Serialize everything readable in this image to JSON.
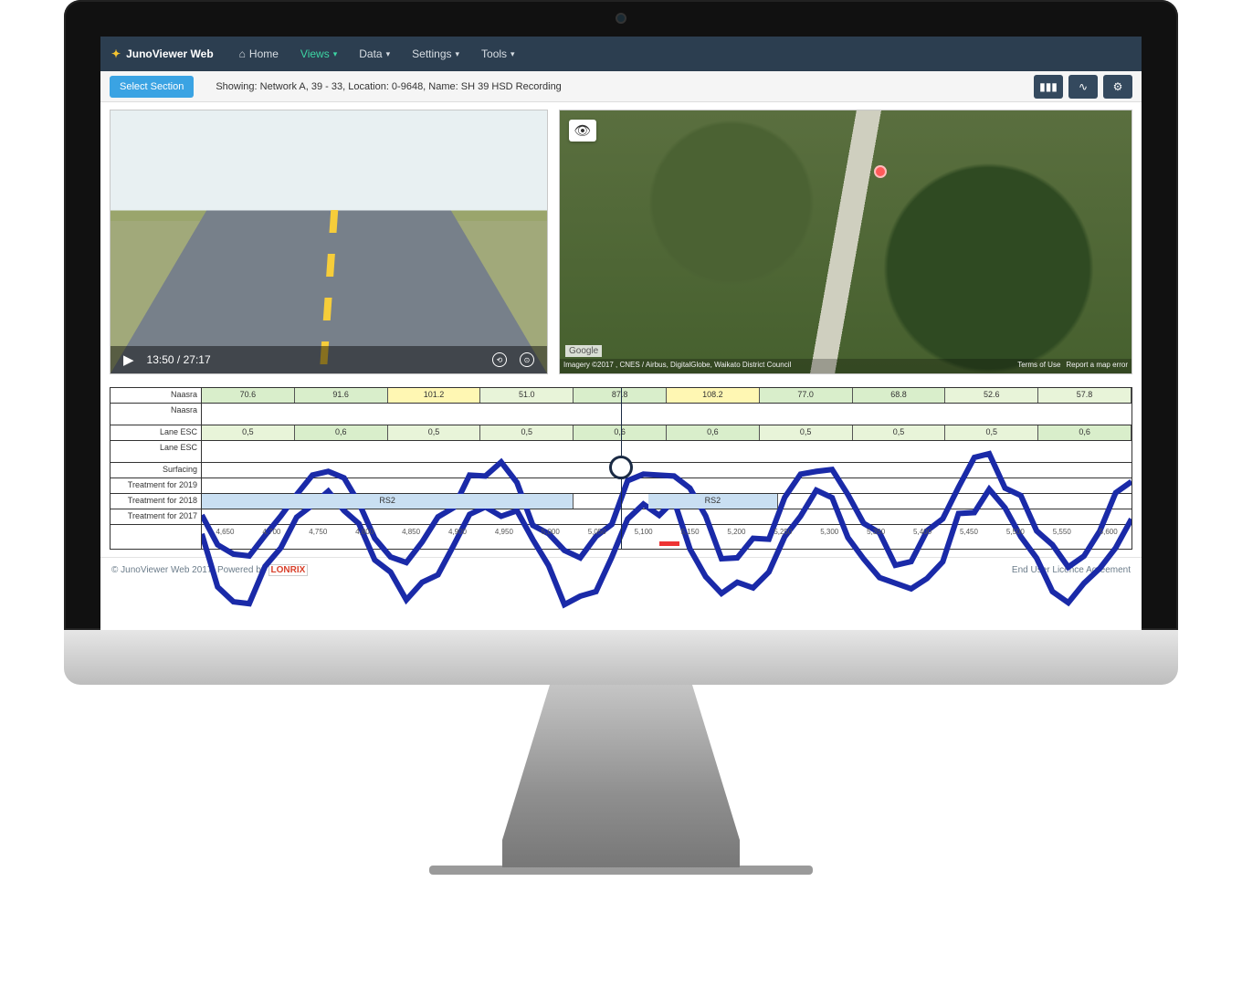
{
  "brand": "JunoViewer Web",
  "nav": {
    "home": "Home",
    "views": "Views",
    "data": "Data",
    "settings": "Settings",
    "tools": "Tools"
  },
  "toolbar": {
    "select_section": "Select Section",
    "showing": "Showing:    Network A,    39 - 33,    Location: 0-9648,    Name: SH 39 HSD Recording"
  },
  "video": {
    "time_current": "13:50",
    "time_total": "27:17"
  },
  "map": {
    "provider": "Google",
    "attribution": "Imagery ©2017 , CNES / Airbus, DigitalGlobe, Waikato District Council",
    "terms": "Terms of Use",
    "report": "Report a map error"
  },
  "chart_data": {
    "rows": [
      {
        "label": "Naasra",
        "type": "cells",
        "values": [
          "70.6",
          "91.6",
          "101.2",
          "51.0",
          "87.8",
          "108.2",
          "77.0",
          "68.8",
          "52.6",
          "57.8"
        ],
        "styles": [
          "g1",
          "g1",
          "y",
          "g2",
          "g1",
          "y",
          "g1",
          "g1",
          "g2",
          "g2"
        ]
      },
      {
        "label": "Naasra",
        "type": "spark"
      },
      {
        "label": "Lane ESC",
        "type": "cells",
        "values": [
          "0,5",
          "0,6",
          "0,5",
          "0,5",
          "0,6",
          "0,6",
          "0,5",
          "0,5",
          "0,5",
          "0,6"
        ],
        "styles": [
          "g2",
          "g1",
          "g2",
          "g2",
          "g1",
          "g1",
          "g2",
          "g2",
          "g2",
          "g1"
        ]
      },
      {
        "label": "Lane ESC",
        "type": "spark"
      },
      {
        "label": "Surfacing",
        "type": "blank"
      },
      {
        "label": "Treatment for 2019",
        "type": "blank"
      },
      {
        "label": "Treatment for 2018",
        "type": "treatment",
        "segments": [
          {
            "label": "RS2",
            "start": 0,
            "end": 0.4
          },
          {
            "label": "RS2",
            "start": 0.48,
            "end": 0.62
          }
        ]
      },
      {
        "label": "Treatment for 2017",
        "type": "blank"
      }
    ],
    "xaxis_ticks": [
      "4,650",
      "4,700",
      "4,750",
      "4,800",
      "4,850",
      "4,900",
      "4,950",
      "5,000",
      "5,050",
      "5,100",
      "5,150",
      "5,200",
      "5,250",
      "5,300",
      "5,350",
      "5,400",
      "5,450",
      "5,500",
      "5,550",
      "5,600"
    ]
  },
  "footer": {
    "copyright": "© JunoViewer Web 2017.  Powered by",
    "powered_by": "LONRIX",
    "eula": "End User Licence Agreement"
  }
}
